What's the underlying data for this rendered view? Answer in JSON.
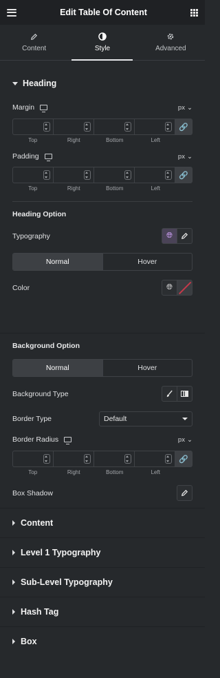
{
  "header": {
    "title": "Edit Table Of Content"
  },
  "tabs": [
    {
      "label": "Content",
      "icon": "pencil-icon"
    },
    {
      "label": "Style",
      "icon": "contrast-icon"
    },
    {
      "label": "Advanced",
      "icon": "gear-icon"
    }
  ],
  "heading_section": {
    "title": "Heading",
    "margin": {
      "label": "Margin",
      "unit": "px"
    },
    "padding": {
      "label": "Padding",
      "unit": "px"
    },
    "dim_labels": [
      "Top",
      "Right",
      "Bottom",
      "Left"
    ]
  },
  "heading_option": {
    "title": "Heading Option",
    "typography_label": "Typography",
    "toggle": [
      "Normal",
      "Hover"
    ],
    "color_label": "Color"
  },
  "background_option": {
    "title": "Background Option",
    "toggle": [
      "Normal",
      "Hover"
    ],
    "background_type_label": "Background Type",
    "border_type_label": "Border Type",
    "border_type_value": "Default",
    "border_radius": {
      "label": "Border Radius",
      "unit": "px"
    },
    "dim_labels": [
      "Top",
      "Right",
      "Bottom",
      "Left"
    ],
    "box_shadow_label": "Box Shadow"
  },
  "collapsed_sections": [
    "Content",
    "Level 1 Typography",
    "Sub-Level Typography",
    "Hash Tag",
    "Box"
  ]
}
